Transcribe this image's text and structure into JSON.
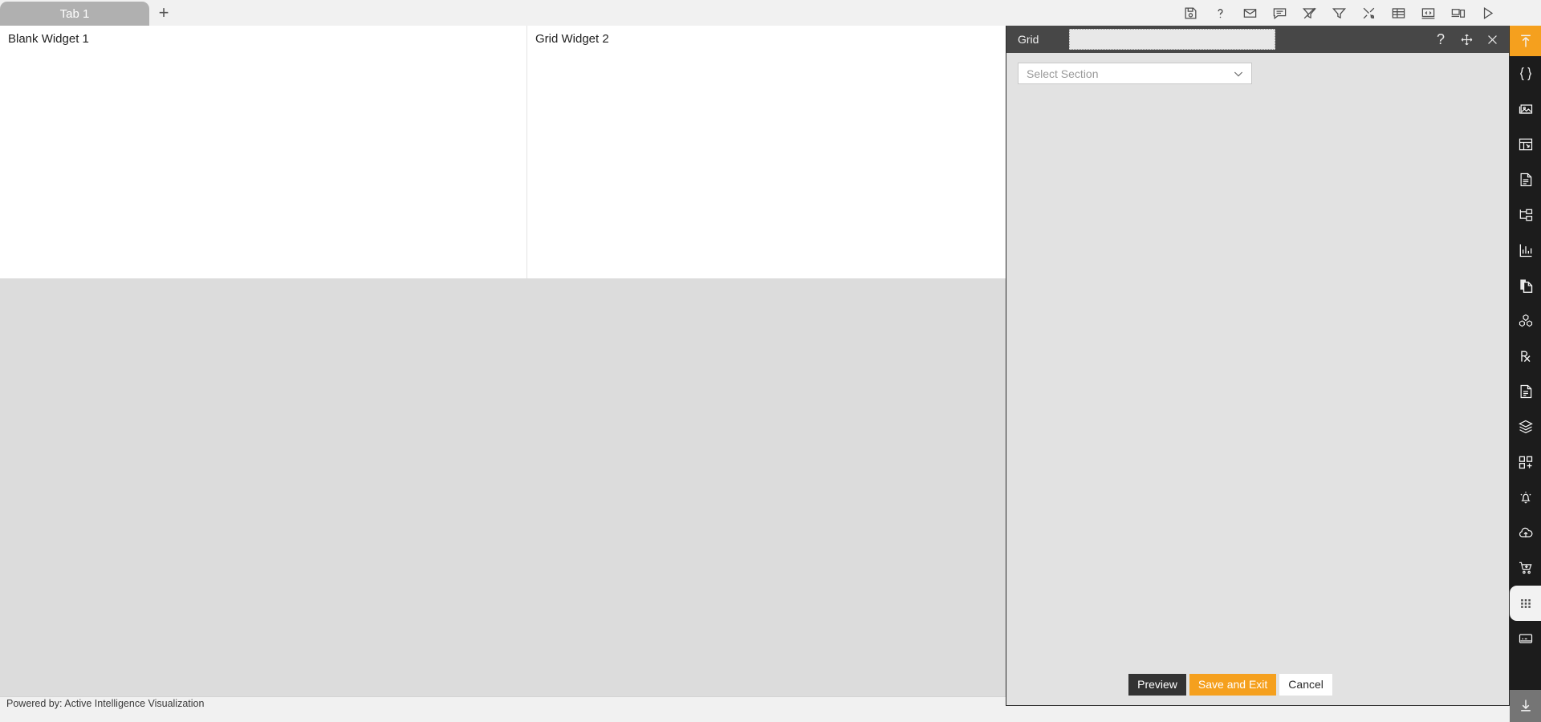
{
  "tabs": {
    "items": [
      {
        "label": "Tab 1",
        "active": true
      }
    ],
    "add_label": "+"
  },
  "top_toolbar": {
    "items": [
      {
        "name": "save-icon",
        "title": "Save"
      },
      {
        "name": "help-icon",
        "title": "Help"
      },
      {
        "name": "mail-icon",
        "title": "Mail"
      },
      {
        "name": "comment-icon",
        "title": "Comment"
      },
      {
        "name": "clear-filter-icon",
        "title": "Clear Filter"
      },
      {
        "name": "filter-icon",
        "title": "Filter"
      },
      {
        "name": "tools-icon",
        "title": "Tools"
      },
      {
        "name": "table-icon",
        "title": "Table"
      },
      {
        "name": "code-icon",
        "title": "Source Code"
      },
      {
        "name": "devices-icon",
        "title": "Devices"
      },
      {
        "name": "play-icon",
        "title": "Run"
      }
    ]
  },
  "canvas": {
    "widgets": [
      {
        "title": "Blank Widget 1"
      },
      {
        "title": "Grid Widget 2"
      }
    ]
  },
  "footer": {
    "powered_by": "Powered by: Active Intelligence Visualization"
  },
  "panel": {
    "title": "Grid",
    "name_input_value": "",
    "name_input_placeholder": "",
    "header_tools": [
      {
        "name": "help-icon",
        "glyph": "?"
      },
      {
        "name": "move-icon"
      },
      {
        "name": "close-icon"
      }
    ],
    "section_select": {
      "placeholder": "Select Section",
      "selected": "",
      "options": [
        "Select Section"
      ]
    },
    "buttons": {
      "preview": "Preview",
      "save_and_exit": "Save and Exit",
      "cancel": "Cancel"
    }
  },
  "rail": {
    "items": [
      {
        "name": "upload-to-bar-icon",
        "state": "active-orange"
      },
      {
        "name": "braces-icon",
        "state": "normal"
      },
      {
        "name": "image-icon",
        "state": "normal"
      },
      {
        "name": "layout-widget-icon",
        "state": "normal"
      },
      {
        "name": "document-icon",
        "state": "normal"
      },
      {
        "name": "folder-tree-icon",
        "state": "normal"
      },
      {
        "name": "chart-icon",
        "state": "normal"
      },
      {
        "name": "copy-page-icon",
        "state": "normal"
      },
      {
        "name": "cubes-icon",
        "state": "normal"
      },
      {
        "name": "prescription-icon",
        "state": "normal"
      },
      {
        "name": "report-icon",
        "state": "normal"
      },
      {
        "name": "layers-icon",
        "state": "normal"
      },
      {
        "name": "add-widget-icon",
        "state": "normal"
      },
      {
        "name": "alert-bell-icon",
        "state": "normal"
      },
      {
        "name": "cloud-upload-icon",
        "state": "normal"
      },
      {
        "name": "cart-icon",
        "state": "normal"
      },
      {
        "name": "grid-dots-icon",
        "state": "active-light"
      },
      {
        "name": "console-icon",
        "state": "normal"
      },
      {
        "name": "download-icon",
        "state": "bottom-dl"
      }
    ]
  },
  "colors": {
    "accent_orange": "#f5a01e",
    "rail_dark": "#1c1c1c",
    "panel_header": "#474747",
    "panel_body": "#e2e2e2",
    "canvas_gray": "#dcdcdc",
    "tab_gray": "#b0b0b0"
  }
}
